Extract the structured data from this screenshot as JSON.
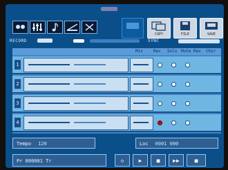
{
  "header": {
    "app_title": "RECORD",
    "sync_label": "SYNC",
    "tool_icons": [
      "record-icon",
      "mix-icon",
      "note-icon",
      "tape-icon",
      "edit-icon"
    ]
  },
  "toolbar": {
    "buttons": [
      {
        "label": "COPY",
        "icon": "copy-icon"
      },
      {
        "label": "FILE",
        "icon": "file-icon"
      },
      {
        "label": "SAVE",
        "icon": "save-icon"
      }
    ]
  },
  "track_table": {
    "columns": [
      "Mix",
      "Rec",
      "Solo",
      "Mute",
      "Rev",
      "Chor"
    ],
    "tracks": [
      {
        "number": "1",
        "record": false
      },
      {
        "number": "2",
        "record": false
      },
      {
        "number": "3",
        "record": false
      },
      {
        "number": "4",
        "record": true
      }
    ]
  },
  "status": {
    "tempo_label": "Tempo",
    "tempo_value": "120",
    "locator_label": "Loc",
    "locator_value": "0001 000"
  },
  "bottom": {
    "position_label": "Pr 000001 Tr",
    "transport": [
      "◇",
      "▶",
      "■",
      "▶▶",
      "■"
    ]
  },
  "colors": {
    "screen": "#0b4f8a",
    "track_row": "#6fb6e3",
    "record_active": "#b01010"
  }
}
